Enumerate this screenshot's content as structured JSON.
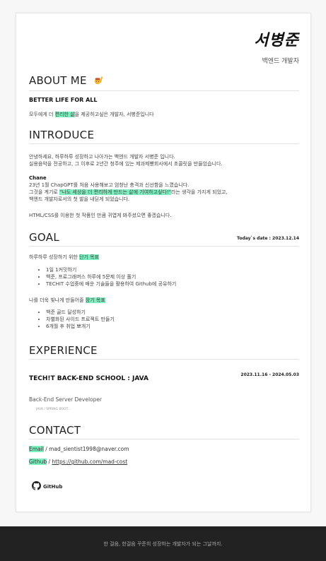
{
  "profile": {
    "name": "서병준",
    "role": "백엔드 개발자"
  },
  "about": {
    "title": "ABOUT ME",
    "icon": "raising-hand-emoji",
    "headline": "BETTER LIFE FOR ALL",
    "line_pre": "모두에게 더 ",
    "line_hl": "편리한 삶",
    "line_post": "을 제공하고싶은 개발자, 서병준입니다"
  },
  "introduce": {
    "title": "INTRODUCE",
    "p1_l1": "안녕하세요, 하루하루 성장하고 나아가는 백엔드 개발자 서병준 입니다.",
    "p1_l2": "실용음악을 전공하고, 그 이후로 2년간 청주에 있는 제과제빵회사에서 초콜릿을 만들었습니다.",
    "p2_head": "Chane",
    "p2_l1": "23년 1월 ChapGPT를 처음 사용해보고 엄청난 충격과 신선함을 느꼈습니다.",
    "p2_l2_pre": "그것을 계기로 ",
    "p2_l2_hl": "\"나도 세상을 더 편리하게 만드는 삶에 기여하고싶다!\"",
    "p2_l2_post": "라는 생각을 가지게 되었고,",
    "p2_l3": "백엔드 개발자로서의 첫 발을 내딛게 되었습니다.",
    "p3": "HTML/CSS를 이용한 첫 작품인 만큼 귀엽게 봐주셨으면 좋겠습니다."
  },
  "goal": {
    "title": "GOAL",
    "today": "Today`s date : 2023.12.14",
    "short_pre": "하루하루 성장하기 위한 ",
    "short_hl": "단기 목표",
    "short_items": [
      "1일 1커밋하기",
      "백준, 프로그래머스 하루에 5문제 이상 풀기",
      "TECHIT 수업중에 배운 기술들을 활용하여 Github에 공유하기"
    ],
    "long_pre": "나를 더욱 빛나게 만들어줄 ",
    "long_hl": "장기 목표",
    "long_items": [
      "백준 골드 달성하기",
      "차별화된 사이드 프로젝트 만들기",
      "6개월 후 취업 뽀개기"
    ]
  },
  "experience": {
    "title": "EXPERIENCE",
    "item_title": "TECH!T BACK-END SCHOOL : JAVA",
    "period": "2023.11.16 - 2024.05.03",
    "position": "Back-End Server Developer",
    "tags": "JAVA / SPRING BOOT..."
  },
  "contact": {
    "title": "CONTACT",
    "email_label": "Email",
    "email_value": "mad_sientist1998@naver.com",
    "github_label": "Github",
    "github_value": "https://github.com/mad-cost",
    "logo_text": "GitHub"
  },
  "footer": {
    "text": "한 걸음, 한걸음 꾸준히 성장하는 개발자가 되는 그날까지."
  },
  "colors": {
    "highlight": "#7ef0c0",
    "footer_bg": "#222222"
  }
}
